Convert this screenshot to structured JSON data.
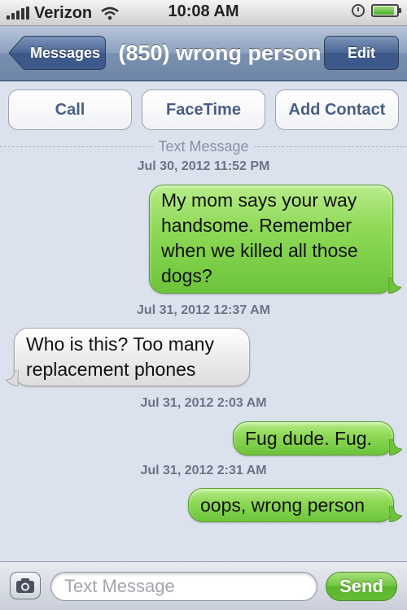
{
  "status_bar": {
    "carrier": "Verizon",
    "time": "10:08 AM",
    "signal_icon": "signal-bars-icon",
    "wifi_icon": "wifi-icon",
    "alarm_icon": "clock-icon",
    "battery_icon": "battery-icon",
    "battery_level": 0.9
  },
  "nav": {
    "back_label": "Messages",
    "title": "(850) wrong person",
    "edit_label": "Edit"
  },
  "actions": {
    "call": "Call",
    "facetime": "FaceTime",
    "add_contact": "Add Contact"
  },
  "thread": {
    "header": "Text Message",
    "timestamps": [
      "Jul 30, 2012 11:52 PM",
      "Jul 31, 2012 12:37 AM",
      "Jul 31, 2012 2:03 AM",
      "Jul 31, 2012 2:31 AM"
    ],
    "messages": [
      {
        "direction": "out",
        "lines": [
          "My mom says your way",
          "handsome. Remember",
          "when we killed all those",
          "dogs?"
        ]
      },
      {
        "direction": "in",
        "lines": [
          "Who is this? Too many",
          "replacement phones"
        ]
      },
      {
        "direction": "out",
        "lines": [
          "Fug dude. Fug."
        ]
      },
      {
        "direction": "out",
        "lines": [
          "oops, wrong person"
        ]
      }
    ]
  },
  "compose": {
    "camera_icon": "camera-icon",
    "placeholder": "Text Message",
    "send_label": "Send"
  },
  "colors": {
    "outgoing_bubble": "#8fd957",
    "incoming_bubble": "#ececec",
    "thread_background": "#dbe2ed",
    "nav_bar": "#7a90b0"
  }
}
